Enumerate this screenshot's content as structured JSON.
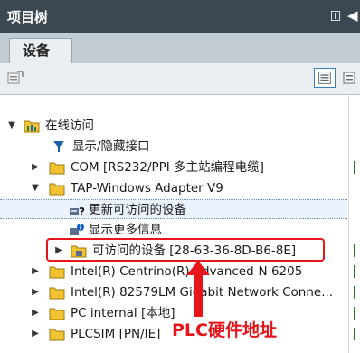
{
  "window": {
    "title": "项目树",
    "collapse_glyph": "◀"
  },
  "tabs": [
    {
      "label": "设备"
    }
  ],
  "tree": {
    "root": {
      "label": "在线访问"
    },
    "items": [
      {
        "label": "显示/隐藏接口"
      },
      {
        "label": "COM [RS232/PPI 多主站编程电缆]"
      },
      {
        "label": "TAP-Windows Adapter V9"
      },
      {
        "label": "更新可访问的设备"
      },
      {
        "label": "显示更多信息"
      },
      {
        "label": "可访问的设备 [28-63-36-8D-B6-8E]"
      },
      {
        "label": "Intel(R) Centrino(R) Advanced-N 6205"
      },
      {
        "label": "Intel(R) 82579LM Gigabit Network Conne..."
      },
      {
        "label": "PC internal [本地]"
      },
      {
        "label": "PLCSIM [PN/IE]"
      }
    ]
  },
  "annotation": {
    "text": "PLC硬件地址"
  },
  "colors": {
    "titlebar": "#3b4852",
    "annotation": "#e5151b",
    "status_green": "#1e7a28"
  }
}
